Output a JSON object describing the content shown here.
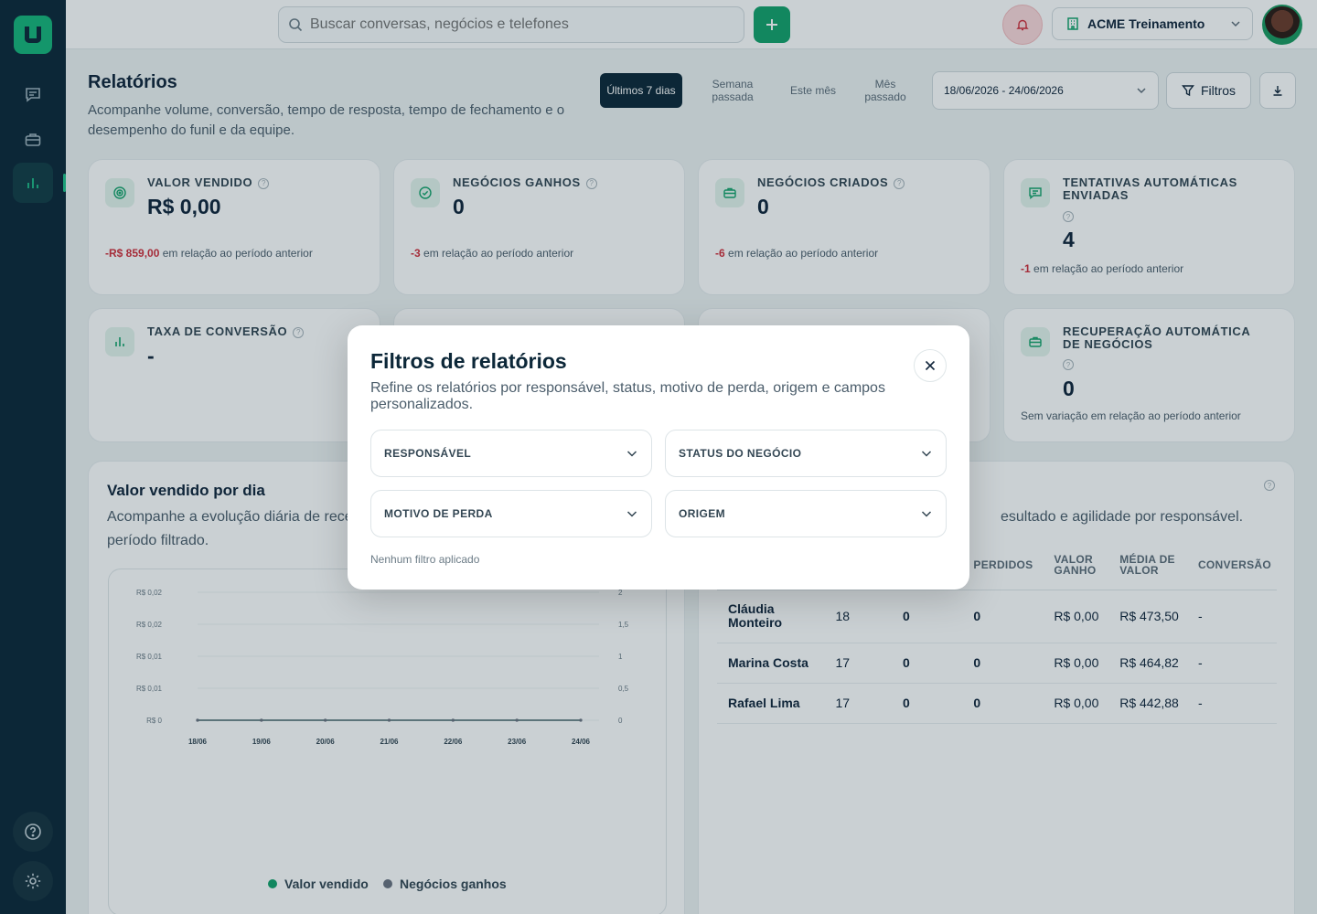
{
  "topbar": {
    "search_placeholder": "Buscar conversas, negócios e telefones",
    "org_name": "ACME Treinamento"
  },
  "header": {
    "title": "Relatórios",
    "subtitle": "Acompanhe volume, conversão, tempo de resposta, tempo de fechamento e o desempenho do funil e da equipe.",
    "periods": [
      "Últimos 7 dias",
      "Semana passada",
      "Este mês",
      "Mês passado"
    ],
    "active_period": "Últimos 7 dias",
    "date_range": "18/06/2026 - 24/06/2026",
    "filters_label": "Filtros"
  },
  "kpis": [
    {
      "label": "VALOR VENDIDO",
      "value": "R$ 0,00",
      "delta": "-R$ 859,00",
      "delta_text": "em relação ao período anterior"
    },
    {
      "label": "NEGÓCIOS GANHOS",
      "value": "0",
      "delta": "-3",
      "delta_text": "em relação ao período anterior"
    },
    {
      "label": "NEGÓCIOS CRIADOS",
      "value": "0",
      "delta": "-6",
      "delta_text": "em relação ao período anterior"
    },
    {
      "label": "TENTATIVAS AUTOMÁTICAS ENVIADAS",
      "value": "4",
      "delta": "-1",
      "delta_text": "em relação ao período anterior"
    },
    {
      "label": "TAXA DE CONVERSÃO",
      "value": "-"
    },
    {
      "label": "RECUPERAÇÃO AUTOMÁTICA DE NEGÓCIOS",
      "value": "0",
      "delta_text": "Sem variação em relação ao período anterior"
    }
  ],
  "chart_panel": {
    "title": "Valor vendido por dia",
    "subtitle": "Acompanhe a evolução diária de rece",
    "subtitle2": "período filtrado."
  },
  "chart_data": {
    "type": "line",
    "x": [
      "18/06",
      "19/06",
      "20/06",
      "21/06",
      "22/06",
      "23/06",
      "24/06"
    ],
    "series": [
      {
        "name": "Valor vendido",
        "values": [
          0,
          0,
          0,
          0,
          0,
          0,
          0
        ],
        "color": "#14a26b"
      },
      {
        "name": "Negócios ganhos",
        "values": [
          0,
          0,
          0,
          0,
          0,
          0,
          0
        ],
        "color": "#6b7380"
      }
    ],
    "y_left_ticks": [
      "R$ 0,02",
      "R$ 0,02",
      "R$ 0,01",
      "R$ 0,01",
      "R$ 0"
    ],
    "y_right_ticks": [
      "2",
      "1,5",
      "1",
      "0,5",
      "0"
    ],
    "ylim_right": [
      0,
      2
    ],
    "legend": "bottom"
  },
  "team_panel": {
    "subtitle": "esultado e agilidade por responsável.",
    "columns": [
      "",
      "",
      "",
      "PERDIDOS",
      "VALOR GANHO",
      "MÉDIA DE VALOR",
      "CONVERSÃO"
    ],
    "rows": [
      {
        "name": "Cláudia Monteiro",
        "total": "18",
        "won": "0",
        "lost": "0",
        "value": "R$ 0,00",
        "avg": "R$ 473,50",
        "conv": "-"
      },
      {
        "name": "Marina Costa",
        "total": "17",
        "won": "0",
        "lost": "0",
        "value": "R$ 0,00",
        "avg": "R$ 464,82",
        "conv": "-"
      },
      {
        "name": "Rafael Lima",
        "total": "17",
        "won": "0",
        "lost": "0",
        "value": "R$ 0,00",
        "avg": "R$ 442,88",
        "conv": "-"
      }
    ]
  },
  "modal": {
    "title": "Filtros de relatórios",
    "subtitle": "Refine os relatórios por responsável, status, motivo de perda, origem e campos personalizados.",
    "selects": [
      "RESPONSÁVEL",
      "STATUS DO NEGÓCIO",
      "MOTIVO DE PERDA",
      "ORIGEM"
    ],
    "empty_text": "Nenhum filtro aplicado"
  }
}
